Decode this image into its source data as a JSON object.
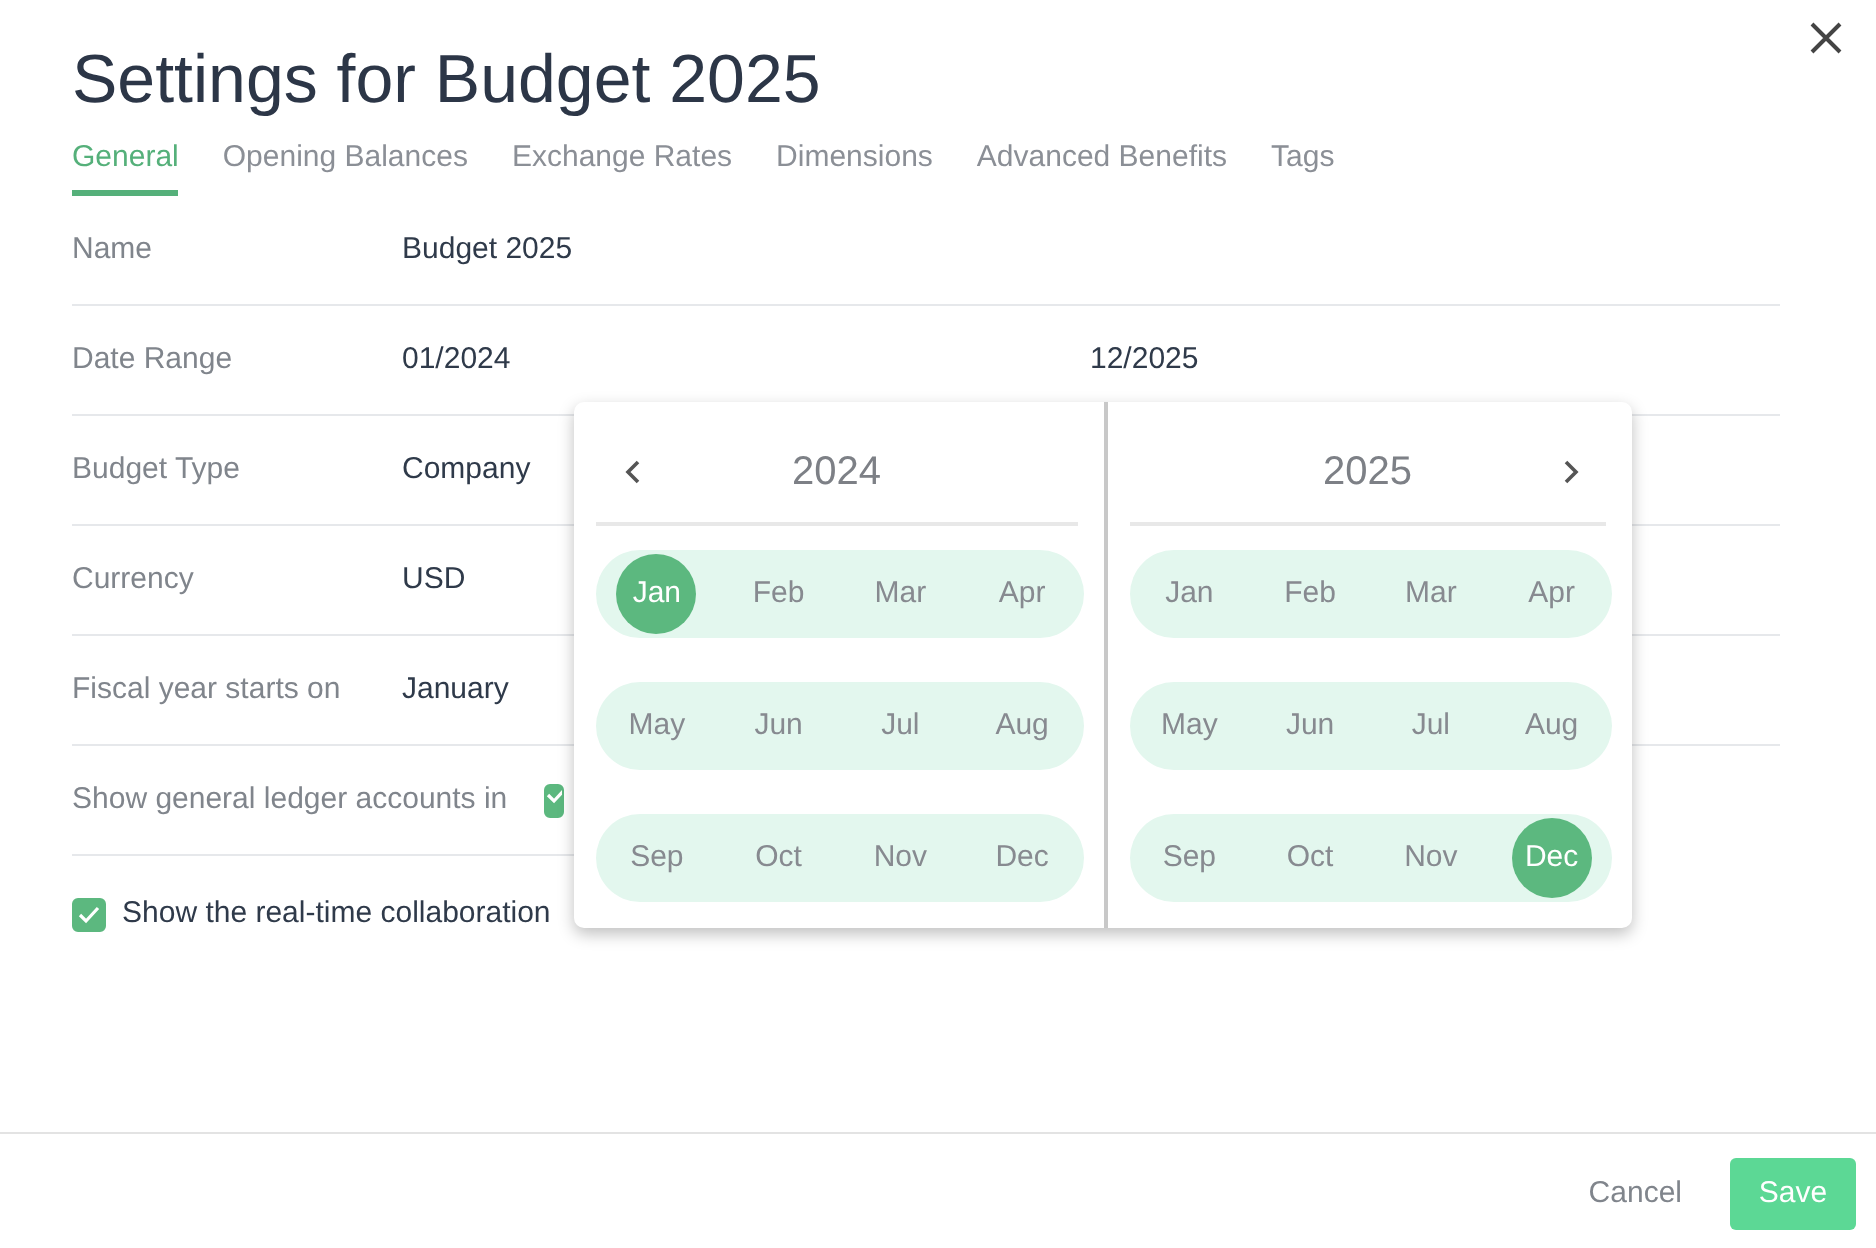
{
  "title": "Settings for Budget 2025",
  "tabs": [
    {
      "label": "General",
      "selected": true
    },
    {
      "label": "Opening Balances",
      "selected": false
    },
    {
      "label": "Exchange Rates",
      "selected": false
    },
    {
      "label": "Dimensions",
      "selected": false
    },
    {
      "label": "Advanced Benefits",
      "selected": false
    },
    {
      "label": "Tags",
      "selected": false
    }
  ],
  "fields": [
    {
      "kind": "text",
      "label": "Name",
      "value": "Budget 2025"
    },
    {
      "kind": "range",
      "label": "Date Range",
      "value": "01/2024",
      "value_end": "12/2025"
    },
    {
      "kind": "text",
      "label": "Budget Type",
      "value": "Company"
    },
    {
      "kind": "text",
      "label": "Currency",
      "value": "USD"
    },
    {
      "kind": "text",
      "label": "Fiscal year starts on",
      "value": "January"
    },
    {
      "kind": "check",
      "label": "Show general ledger accounts in",
      "checked": true
    }
  ],
  "collaboration": {
    "label": "Show the real-time collaboration",
    "checked": true
  },
  "picker": [
    {
      "year": "2024",
      "kind": "prev",
      "months": [
        {
          "label": "Jan",
          "selected": true
        },
        {
          "label": "Feb",
          "selected": false
        },
        {
          "label": "Mar",
          "selected": false
        },
        {
          "label": "Apr",
          "selected": false
        },
        {
          "label": "May",
          "selected": false
        },
        {
          "label": "Jun",
          "selected": false
        },
        {
          "label": "Jul",
          "selected": false
        },
        {
          "label": "Aug",
          "selected": false
        },
        {
          "label": "Sep",
          "selected": false
        },
        {
          "label": "Oct",
          "selected": false
        },
        {
          "label": "Nov",
          "selected": false
        },
        {
          "label": "Dec",
          "selected": false
        }
      ]
    },
    {
      "year": "2025",
      "kind": "next",
      "months": [
        {
          "label": "Jan",
          "selected": false
        },
        {
          "label": "Feb",
          "selected": false
        },
        {
          "label": "Mar",
          "selected": false
        },
        {
          "label": "Apr",
          "selected": false
        },
        {
          "label": "May",
          "selected": false
        },
        {
          "label": "Jun",
          "selected": false
        },
        {
          "label": "Jul",
          "selected": false
        },
        {
          "label": "Aug",
          "selected": false
        },
        {
          "label": "Sep",
          "selected": false
        },
        {
          "label": "Oct",
          "selected": false
        },
        {
          "label": "Nov",
          "selected": false
        },
        {
          "label": "Dec",
          "selected": true
        }
      ]
    }
  ],
  "buttons": [
    {
      "kind": "cancel",
      "label": "Cancel"
    },
    {
      "kind": "save",
      "label": "Save"
    }
  ]
}
